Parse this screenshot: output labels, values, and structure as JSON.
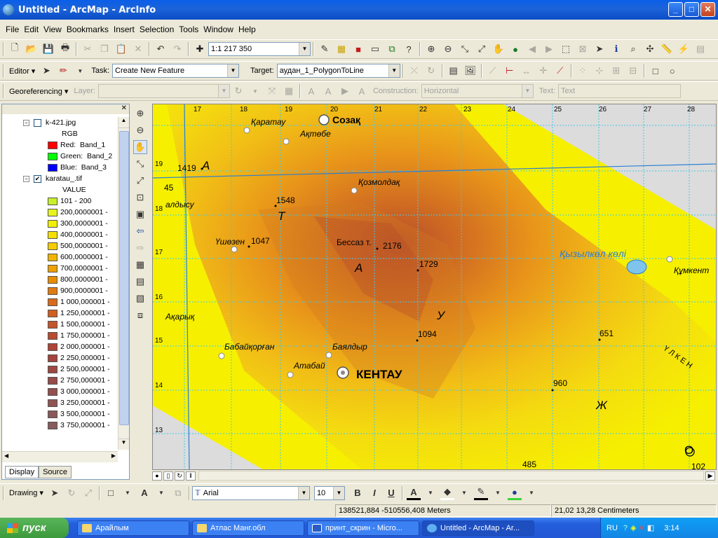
{
  "window": {
    "title": "Untitled - ArcMap - ArcInfo",
    "buttons": {
      "minimize": "_",
      "maximize": "□",
      "close": "✕"
    }
  },
  "menu": [
    "File",
    "Edit",
    "View",
    "Bookmarks",
    "Insert",
    "Selection",
    "Tools",
    "Window",
    "Help"
  ],
  "standard_toolbar": {
    "scale": "1:1 217 350"
  },
  "editor_toolbar": {
    "editor_label": "Editor ▾",
    "task_label": "Task:",
    "task_value": "Create New Feature",
    "target_label": "Target:",
    "target_value": "аудан_1_PolygonToLine"
  },
  "georef_toolbar": {
    "georef_label": "Georeferencing ▾",
    "layer_label": "Layer:",
    "construction_label": "Construction:",
    "construction_value": "Horizontal",
    "text_label": "Text:",
    "text_value": "Text"
  },
  "toc": {
    "layer1": {
      "name": "k-421.jpg",
      "checked": false,
      "band_type": "RGB",
      "bands": [
        {
          "label": "Red:",
          "band": "Band_1",
          "color": "#ff0000"
        },
        {
          "label": "Green:",
          "band": "Band_2",
          "color": "#00ff00"
        },
        {
          "label": "Blue:",
          "band": "Band_3",
          "color": "#0000ff"
        }
      ]
    },
    "layer2": {
      "name": "karatau_.tif",
      "checked": true,
      "field": "VALUE",
      "classes": [
        {
          "label": "101 - 200",
          "color": "#c8f02a"
        },
        {
          "label": "200,0000001 -",
          "color": "#e6f51e"
        },
        {
          "label": "300,0000001 -",
          "color": "#f0f000"
        },
        {
          "label": "400,0000001 -",
          "color": "#f5e000"
        },
        {
          "label": "500,0000001 -",
          "color": "#f5cd00"
        },
        {
          "label": "600,0000001 -",
          "color": "#f0b400"
        },
        {
          "label": "700,0000001 -",
          "color": "#eda000"
        },
        {
          "label": "800,0000001 -",
          "color": "#e88c00"
        },
        {
          "label": "900,0000001 -",
          "color": "#e07a10"
        },
        {
          "label": "1 000,000001 -",
          "color": "#d86a1a"
        },
        {
          "label": "1 250,000001 -",
          "color": "#cf5f22"
        },
        {
          "label": "1 500,000001 -",
          "color": "#c4552a"
        },
        {
          "label": "1 750,000001 -",
          "color": "#b84c30"
        },
        {
          "label": "2 000,000001 -",
          "color": "#ad4536"
        },
        {
          "label": "2 250,000001 -",
          "color": "#a4443c"
        },
        {
          "label": "2 500,000001 -",
          "color": "#9c4842"
        },
        {
          "label": "2 750,000001 -",
          "color": "#964c48"
        },
        {
          "label": "3 000,000001 -",
          "color": "#92504e"
        },
        {
          "label": "3 250,000001 -",
          "color": "#8e5454"
        },
        {
          "label": "3 500,000001 -",
          "color": "#8a5858"
        },
        {
          "label": "3 750,000001 -",
          "color": "#865c5c"
        }
      ]
    },
    "tabs": [
      "Display",
      "Source"
    ]
  },
  "map": {
    "top_ruler": [
      "17",
      "18",
      "19",
      "20",
      "21",
      "22",
      "23",
      "24",
      "25",
      "26",
      "27",
      "28"
    ],
    "left_ruler": [
      "19",
      "18",
      "17",
      "16",
      "15",
      "14",
      "13"
    ],
    "places": {
      "karatau": "Қаратау",
      "aktobe": "Ақтөбе",
      "sozak": "Созақ",
      "kozmoldak": "Қозмолдақ",
      "ushozen": "Үшөзен",
      "bessaz": "Бессаз т.",
      "kyzylkol": "Қызылкөл көлі",
      "kumkent": "Құмкент",
      "akaryk": "Ақарық",
      "babaikorgan": "Бабайқорған",
      "bayaldyr": "Баялдыр",
      "atabai": "Атабай",
      "kentau": "КЕНТАУ",
      "aldysu": "алдысу",
      "ulken": "Ү Л К Е Н"
    },
    "heights": {
      "h1419": "1419",
      "h1548": "1548",
      "h1047": "1047",
      "h2176": "2176",
      "h1729": "1729",
      "h1094": "1094",
      "h651": "651",
      "h960": "960",
      "h485": "485",
      "h45": "45",
      "h102": "102"
    },
    "letters": {
      "a1": "А",
      "t": "Т",
      "a2": "А",
      "u": "У",
      "zh": "Ж",
      "o": "О"
    }
  },
  "drawing_toolbar": {
    "drawing_label": "Drawing ▾",
    "font": "Arial",
    "size": "10",
    "bold": "B",
    "italic": "I",
    "underline": "U"
  },
  "status": {
    "coords": "138521,884  -510556,408 Meters",
    "page": "21,02  13,28 Centimeters"
  },
  "taskbar": {
    "start": "пуск",
    "tasks": [
      "Арайлым",
      "Атлас Манг.обл",
      "принт_скрин - Micro...",
      "Untitled - ArcMap - Ar..."
    ],
    "lang": "RU",
    "time": "3:14"
  }
}
